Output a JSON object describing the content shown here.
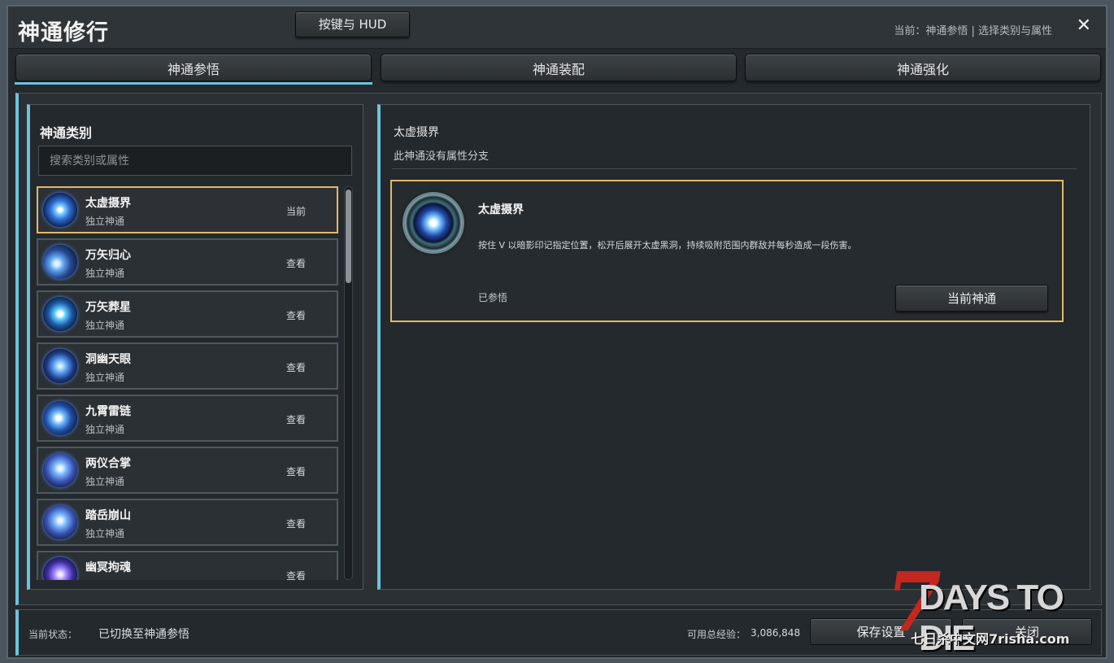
{
  "window": {
    "title": "神通修行",
    "hud_button": "按键与 HUD",
    "breadcrumb": "当前：神通参悟 | 选择类别与属性",
    "close_symbol": "✕"
  },
  "tabs": [
    {
      "label": "神通参悟",
      "active": true
    },
    {
      "label": "神通装配",
      "active": false
    },
    {
      "label": "神通强化",
      "active": false
    }
  ],
  "left_panel": {
    "title": "神通类别",
    "search_placeholder": "搜索类别或属性",
    "items": [
      {
        "name": "太虚摄界",
        "type": "独立神通",
        "state": "当前",
        "selected": true
      },
      {
        "name": "万矢归心",
        "type": "独立神通",
        "state": "查看"
      },
      {
        "name": "万矢葬星",
        "type": "独立神通",
        "state": "查看"
      },
      {
        "name": "洞幽天眼",
        "type": "独立神通",
        "state": "查看"
      },
      {
        "name": "九霄雷链",
        "type": "独立神通",
        "state": "查看"
      },
      {
        "name": "两仪合掌",
        "type": "独立神通",
        "state": "查看"
      },
      {
        "name": "踏岳崩山",
        "type": "独立神通",
        "state": "查看"
      },
      {
        "name": "幽冥拘魂",
        "type": "",
        "state": "查看"
      }
    ]
  },
  "right_panel": {
    "title": "太虚摄界",
    "subtitle": "此神通没有属性分支",
    "card": {
      "name": "太虚摄界",
      "description": "按住 V 以暗影印记指定位置，松开后展开太虚黑洞，持续吸附范围内群敌并每秒造成一段伤害。",
      "status": "已参悟",
      "button": "当前神通"
    }
  },
  "status_bar": {
    "label": "当前状态：",
    "value": "已切换至神通参悟",
    "exp_label": "可用总经验：",
    "exp_value": "3,086,848",
    "save_button": "保存设置",
    "close_button": "关闭"
  },
  "watermark": {
    "seven": "7",
    "brand": "DAYS TO DIE",
    "site": "七日杀中文网7risha.com"
  },
  "colors": {
    "accent": "#6cc3dd",
    "selected_border": "#e3b968",
    "panel": "#24292d"
  }
}
